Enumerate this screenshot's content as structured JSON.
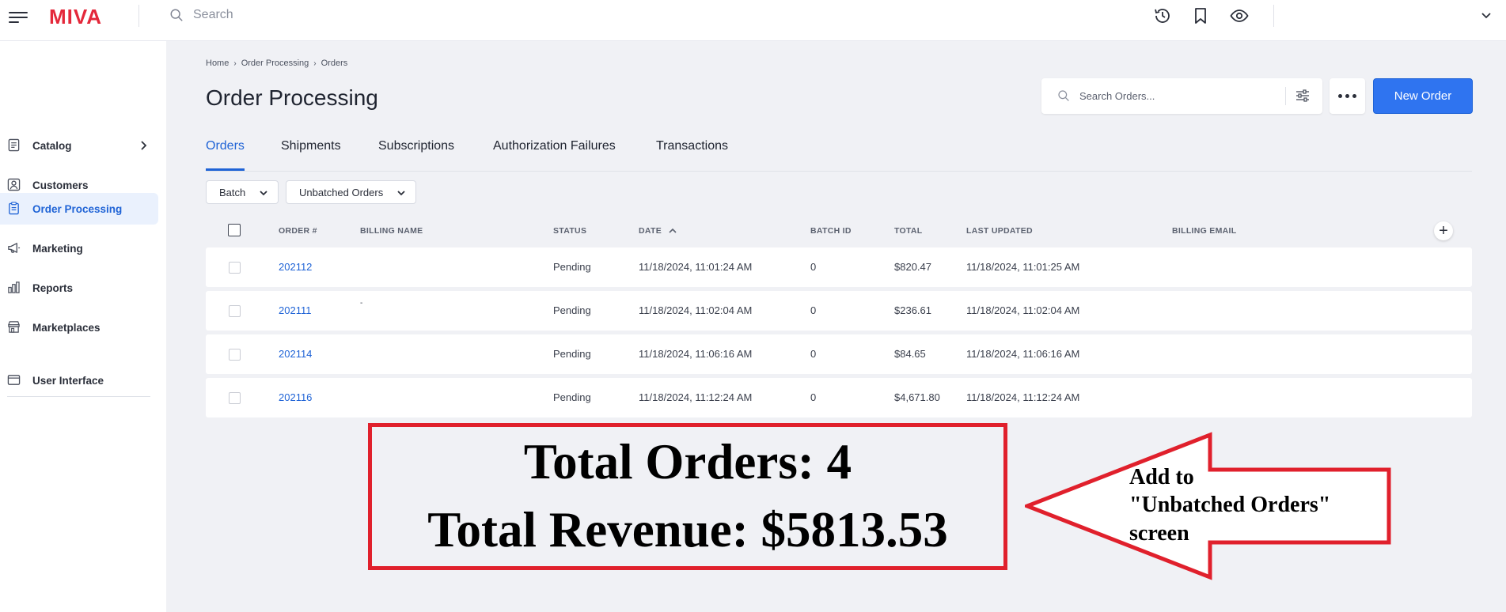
{
  "topbar": {
    "logo": "MIVA",
    "search_placeholder": "Search"
  },
  "sidebar": {
    "items": [
      {
        "label": "Catalog",
        "icon": "catalog-icon"
      },
      {
        "label": "Customers",
        "icon": "customers-icon"
      },
      {
        "label": "Order Processing",
        "icon": "order-processing-icon"
      },
      {
        "label": "Marketing",
        "icon": "megaphone-icon"
      },
      {
        "label": "Reports",
        "icon": "bar-chart-icon"
      },
      {
        "label": "Marketplaces",
        "icon": "storefront-icon"
      },
      {
        "label": "User Interface",
        "icon": "window-icon"
      }
    ]
  },
  "breadcrumb": [
    "Home",
    "Order Processing",
    "Orders"
  ],
  "page_title": "Order Processing",
  "order_search_placeholder": "Search Orders...",
  "new_order_label": "New Order",
  "tabs": [
    "Orders",
    "Shipments",
    "Subscriptions",
    "Authorization Failures",
    "Transactions"
  ],
  "filters": {
    "batch": "Batch",
    "view": "Unbatched Orders"
  },
  "table": {
    "headers": [
      "ORDER #",
      "BILLING NAME",
      "STATUS",
      "DATE",
      "BATCH ID",
      "TOTAL",
      "LAST UPDATED",
      "BILLING EMAIL"
    ],
    "rows": [
      {
        "order": "202112",
        "billing_name": "",
        "status": "Pending",
        "date": "11/18/2024, 11:01:24 AM",
        "batch": "0",
        "total": "$820.47",
        "updated": "11/18/2024, 11:01:25 AM"
      },
      {
        "order": "202111",
        "billing_name": "-",
        "status": "Pending",
        "date": "11/18/2024, 11:02:04 AM",
        "batch": "0",
        "total": "$236.61",
        "updated": "11/18/2024, 11:02:04 AM"
      },
      {
        "order": "202114",
        "billing_name": "",
        "status": "Pending",
        "date": "11/18/2024, 11:06:16 AM",
        "batch": "0",
        "total": "$84.65",
        "updated": "11/18/2024, 11:06:16 AM"
      },
      {
        "order": "202116",
        "billing_name": "",
        "status": "Pending",
        "date": "11/18/2024, 11:12:24 AM",
        "batch": "0",
        "total": "$4,671.80",
        "updated": "11/18/2024, 11:12:24 AM"
      }
    ]
  },
  "annotation": {
    "total_orders": "Total Orders: 4",
    "total_revenue": "Total Revenue: $5813.53",
    "arrow_lines": [
      "Add to",
      "\"Unbatched Orders\"",
      "screen"
    ],
    "color": "#e0202c"
  }
}
